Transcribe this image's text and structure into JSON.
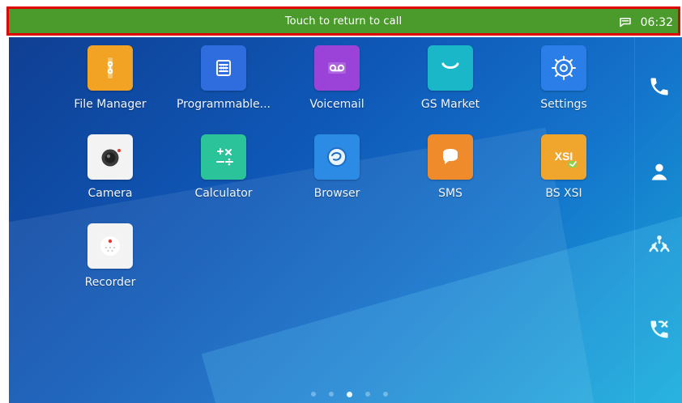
{
  "status_bar": {
    "message": "Touch to return to call",
    "time": "06:32",
    "icons": [
      "call-in-progress-icon"
    ]
  },
  "apps": [
    {
      "label": "File Manager",
      "icon": "file-manager-icon",
      "bg": "#f2a323"
    },
    {
      "label": "Programmable...",
      "icon": "programmable-keys-icon",
      "bg": "#2f6ddf"
    },
    {
      "label": "Voicemail",
      "icon": "voicemail-icon",
      "bg": "#9b43d8"
    },
    {
      "label": "GS Market",
      "icon": "gs-market-icon",
      "bg": "#19b7c7"
    },
    {
      "label": "Settings",
      "icon": "settings-icon",
      "bg": "#2b7de7"
    },
    {
      "label": "Camera",
      "icon": "camera-icon",
      "bg": "#f3f3f3"
    },
    {
      "label": "Calculator",
      "icon": "calculator-icon",
      "bg": "#2bc39a"
    },
    {
      "label": "Browser",
      "icon": "browser-icon",
      "bg": "#2b8be5"
    },
    {
      "label": "SMS",
      "icon": "sms-icon",
      "bg": "#ef8b2a"
    },
    {
      "label": "BS XSI",
      "icon": "bs-xsi-icon",
      "bg": "#f0a52d"
    },
    {
      "label": "Recorder",
      "icon": "recorder-icon",
      "bg": "#f3f3f3"
    }
  ],
  "dock": {
    "items": [
      {
        "name": "phone",
        "icon": "phone-icon"
      },
      {
        "name": "contacts",
        "icon": "contact-icon"
      },
      {
        "name": "conference",
        "icon": "conference-icon"
      },
      {
        "name": "call-history",
        "icon": "call-history-icon"
      }
    ]
  },
  "pager": {
    "count": 5,
    "active_index": 2
  }
}
